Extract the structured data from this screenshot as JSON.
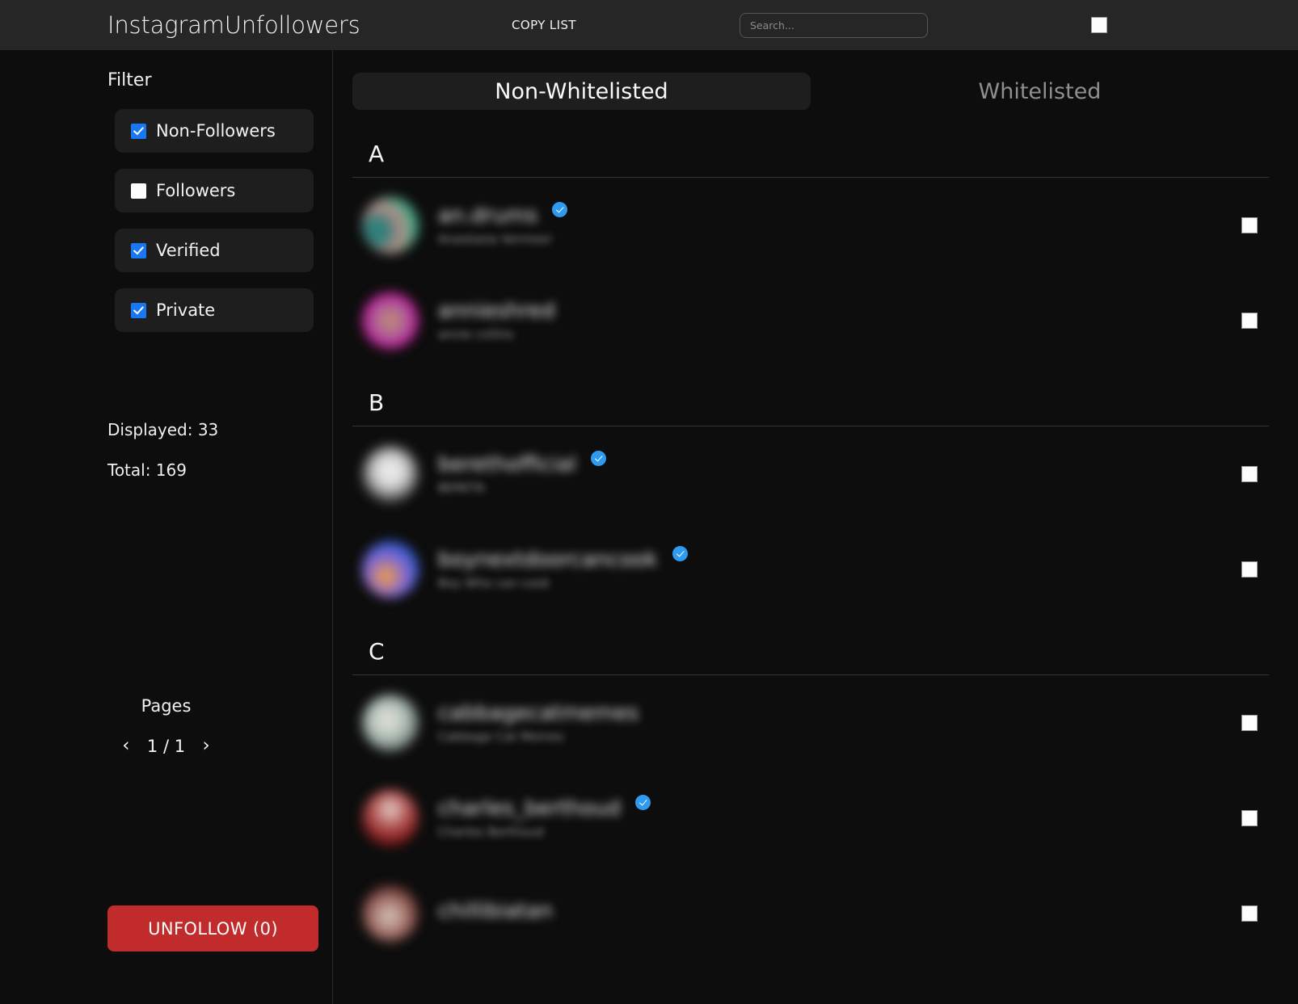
{
  "header": {
    "brand": "InstagramUnfollowers",
    "copy_list_label": "COPY LIST",
    "search_placeholder": "Search...",
    "search_value": "",
    "select_all_checked": false
  },
  "sidebar": {
    "filter_title": "Filter",
    "filters": [
      {
        "label": "Non-Followers",
        "checked": true
      },
      {
        "label": "Followers",
        "checked": false
      },
      {
        "label": "Verified",
        "checked": true
      },
      {
        "label": "Private",
        "checked": true
      }
    ],
    "displayed_label": "Displayed: 33",
    "total_label": "Total: 169",
    "pages_title": "Pages",
    "prev_icon": "‹",
    "next_icon": "›",
    "page_count_label": "1 / 1",
    "unfollow_label": "UNFOLLOW (0)",
    "unfollow_color": "#c22b2b",
    "accent_color": "#1877f2"
  },
  "main": {
    "tabs": [
      {
        "label": "Non-Whitelisted",
        "active": true
      },
      {
        "label": "Whitelisted",
        "active": false
      }
    ],
    "sections": [
      {
        "letter": "A",
        "rows": [
          {
            "username": "an.drums",
            "fullname": "Anastasia Vermeer",
            "verified": true,
            "checked": false,
            "avatar": "av-a"
          },
          {
            "username": "annieshred",
            "fullname": "annie collins",
            "verified": false,
            "checked": false,
            "avatar": "av-b"
          }
        ]
      },
      {
        "letter": "B",
        "rows": [
          {
            "username": "berethofficial",
            "fullname": "BERETA",
            "verified": true,
            "checked": false,
            "avatar": "av-c"
          },
          {
            "username": "boynextdoorcancook",
            "fullname": "Boy Who can cook",
            "verified": true,
            "checked": false,
            "avatar": "av-d"
          }
        ]
      },
      {
        "letter": "C",
        "rows": [
          {
            "username": "cabbagecatmemes",
            "fullname": "Cabbage Cat Memes",
            "verified": false,
            "checked": false,
            "avatar": "av-e"
          },
          {
            "username": "charles_berthoud",
            "fullname": "Charles Berthoud",
            "verified": true,
            "checked": false,
            "avatar": "av-f"
          },
          {
            "username": "chillibiatan",
            "fullname": "",
            "verified": false,
            "checked": false,
            "avatar": "av-g"
          }
        ]
      }
    ]
  }
}
